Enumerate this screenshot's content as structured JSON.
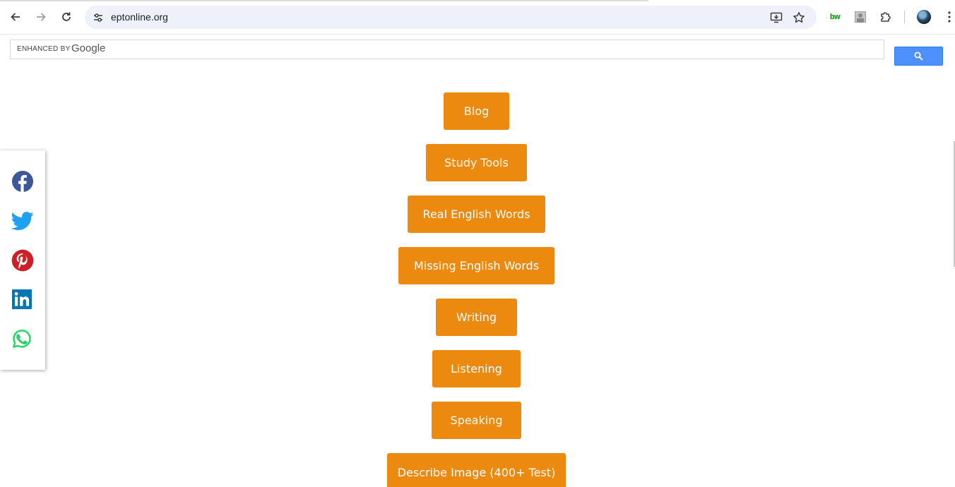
{
  "browser": {
    "url": "eptonline.org",
    "extension_label": "bw"
  },
  "search": {
    "enhanced_by": "ENHANCED BY",
    "provider": "Google"
  },
  "menu": {
    "items": [
      {
        "label": "Blog"
      },
      {
        "label": "Study Tools"
      },
      {
        "label": "Real English Words"
      },
      {
        "label": "Missing English Words"
      },
      {
        "label": "Writing"
      },
      {
        "label": "Listening"
      },
      {
        "label": "Speaking"
      },
      {
        "label": "Describe Image (400+ Test)"
      }
    ]
  },
  "share_icons": [
    "facebook-icon",
    "twitter-icon",
    "pinterest-icon",
    "linkedin-icon",
    "whatsapp-icon"
  ],
  "colors": {
    "menu_button": "#ec890f",
    "search_button": "#4d90fe",
    "facebook": "#3b5998",
    "twitter": "#1da1f2",
    "pinterest": "#cb2027",
    "linkedin": "#0077b5",
    "whatsapp": "#25d366"
  }
}
